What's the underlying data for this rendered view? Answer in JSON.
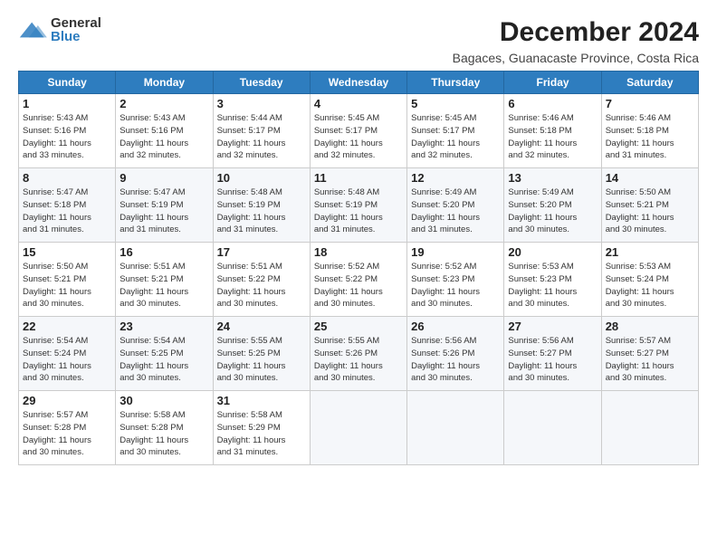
{
  "logo": {
    "general": "General",
    "blue": "Blue",
    "tagline": ""
  },
  "title": "December 2024",
  "subtitle": "Bagaces, Guanacaste Province, Costa Rica",
  "weekdays": [
    "Sunday",
    "Monday",
    "Tuesday",
    "Wednesday",
    "Thursday",
    "Friday",
    "Saturday"
  ],
  "weeks": [
    [
      {
        "day": "1",
        "info": "Sunrise: 5:43 AM\nSunset: 5:16 PM\nDaylight: 11 hours\nand 33 minutes."
      },
      {
        "day": "2",
        "info": "Sunrise: 5:43 AM\nSunset: 5:16 PM\nDaylight: 11 hours\nand 32 minutes."
      },
      {
        "day": "3",
        "info": "Sunrise: 5:44 AM\nSunset: 5:17 PM\nDaylight: 11 hours\nand 32 minutes."
      },
      {
        "day": "4",
        "info": "Sunrise: 5:45 AM\nSunset: 5:17 PM\nDaylight: 11 hours\nand 32 minutes."
      },
      {
        "day": "5",
        "info": "Sunrise: 5:45 AM\nSunset: 5:17 PM\nDaylight: 11 hours\nand 32 minutes."
      },
      {
        "day": "6",
        "info": "Sunrise: 5:46 AM\nSunset: 5:18 PM\nDaylight: 11 hours\nand 32 minutes."
      },
      {
        "day": "7",
        "info": "Sunrise: 5:46 AM\nSunset: 5:18 PM\nDaylight: 11 hours\nand 31 minutes."
      }
    ],
    [
      {
        "day": "8",
        "info": "Sunrise: 5:47 AM\nSunset: 5:18 PM\nDaylight: 11 hours\nand 31 minutes."
      },
      {
        "day": "9",
        "info": "Sunrise: 5:47 AM\nSunset: 5:19 PM\nDaylight: 11 hours\nand 31 minutes."
      },
      {
        "day": "10",
        "info": "Sunrise: 5:48 AM\nSunset: 5:19 PM\nDaylight: 11 hours\nand 31 minutes."
      },
      {
        "day": "11",
        "info": "Sunrise: 5:48 AM\nSunset: 5:19 PM\nDaylight: 11 hours\nand 31 minutes."
      },
      {
        "day": "12",
        "info": "Sunrise: 5:49 AM\nSunset: 5:20 PM\nDaylight: 11 hours\nand 31 minutes."
      },
      {
        "day": "13",
        "info": "Sunrise: 5:49 AM\nSunset: 5:20 PM\nDaylight: 11 hours\nand 30 minutes."
      },
      {
        "day": "14",
        "info": "Sunrise: 5:50 AM\nSunset: 5:21 PM\nDaylight: 11 hours\nand 30 minutes."
      }
    ],
    [
      {
        "day": "15",
        "info": "Sunrise: 5:50 AM\nSunset: 5:21 PM\nDaylight: 11 hours\nand 30 minutes."
      },
      {
        "day": "16",
        "info": "Sunrise: 5:51 AM\nSunset: 5:21 PM\nDaylight: 11 hours\nand 30 minutes."
      },
      {
        "day": "17",
        "info": "Sunrise: 5:51 AM\nSunset: 5:22 PM\nDaylight: 11 hours\nand 30 minutes."
      },
      {
        "day": "18",
        "info": "Sunrise: 5:52 AM\nSunset: 5:22 PM\nDaylight: 11 hours\nand 30 minutes."
      },
      {
        "day": "19",
        "info": "Sunrise: 5:52 AM\nSunset: 5:23 PM\nDaylight: 11 hours\nand 30 minutes."
      },
      {
        "day": "20",
        "info": "Sunrise: 5:53 AM\nSunset: 5:23 PM\nDaylight: 11 hours\nand 30 minutes."
      },
      {
        "day": "21",
        "info": "Sunrise: 5:53 AM\nSunset: 5:24 PM\nDaylight: 11 hours\nand 30 minutes."
      }
    ],
    [
      {
        "day": "22",
        "info": "Sunrise: 5:54 AM\nSunset: 5:24 PM\nDaylight: 11 hours\nand 30 minutes."
      },
      {
        "day": "23",
        "info": "Sunrise: 5:54 AM\nSunset: 5:25 PM\nDaylight: 11 hours\nand 30 minutes."
      },
      {
        "day": "24",
        "info": "Sunrise: 5:55 AM\nSunset: 5:25 PM\nDaylight: 11 hours\nand 30 minutes."
      },
      {
        "day": "25",
        "info": "Sunrise: 5:55 AM\nSunset: 5:26 PM\nDaylight: 11 hours\nand 30 minutes."
      },
      {
        "day": "26",
        "info": "Sunrise: 5:56 AM\nSunset: 5:26 PM\nDaylight: 11 hours\nand 30 minutes."
      },
      {
        "day": "27",
        "info": "Sunrise: 5:56 AM\nSunset: 5:27 PM\nDaylight: 11 hours\nand 30 minutes."
      },
      {
        "day": "28",
        "info": "Sunrise: 5:57 AM\nSunset: 5:27 PM\nDaylight: 11 hours\nand 30 minutes."
      }
    ],
    [
      {
        "day": "29",
        "info": "Sunrise: 5:57 AM\nSunset: 5:28 PM\nDaylight: 11 hours\nand 30 minutes."
      },
      {
        "day": "30",
        "info": "Sunrise: 5:58 AM\nSunset: 5:28 PM\nDaylight: 11 hours\nand 30 minutes."
      },
      {
        "day": "31",
        "info": "Sunrise: 5:58 AM\nSunset: 5:29 PM\nDaylight: 11 hours\nand 31 minutes."
      },
      {
        "day": "",
        "info": ""
      },
      {
        "day": "",
        "info": ""
      },
      {
        "day": "",
        "info": ""
      },
      {
        "day": "",
        "info": ""
      }
    ]
  ]
}
